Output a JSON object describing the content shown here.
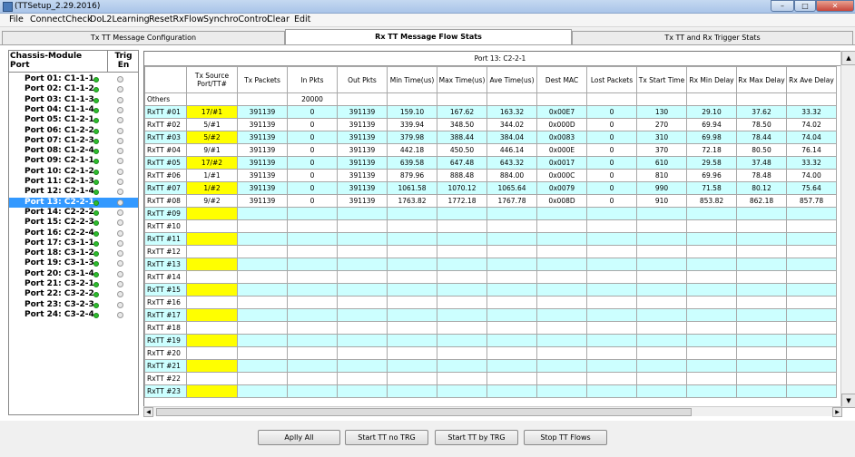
{
  "window": {
    "title": "(TTSetup_2.29.2016)",
    "min": "–",
    "max": "□",
    "close": "✕"
  },
  "menu": [
    "File",
    "ConnectCheck",
    "DoL2Learning",
    "ResetRxFlow",
    "SynchroControl",
    "Clear",
    "Edit"
  ],
  "tabs": [
    "Tx TT Message Configuration",
    "Rx TT Message Flow Stats",
    "Tx TT and Rx Trigger Stats"
  ],
  "left": {
    "h1": "Chassis-Module",
    "h2": "Port",
    "t1": "Trig",
    "t2": "En",
    "ports": [
      "Port 01:  C1-1-1",
      "Port 02:  C1-1-2",
      "Port 03:  C1-1-3",
      "Port 04:  C1-1-4",
      "Port 05:  C1-2-1",
      "Port 06:  C1-2-2",
      "Port 07:  C1-2-3",
      "Port 08:  C1-2-4",
      "Port 09:  C2-1-1",
      "Port 10:  C2-1-2",
      "Port 11:  C2-1-3",
      "Port 12:  C2-1-4",
      "Port 13:  C2-2-1",
      "Port 14:  C2-2-2",
      "Port 15:  C2-2-3",
      "Port 16:  C2-2-4",
      "Port 17:  C3-1-1",
      "Port 18:  C3-1-2",
      "Port 19:  C3-1-3",
      "Port 20:  C3-1-4",
      "Port 21:  C3-2-1",
      "Port 22:  C3-2-2",
      "Port 23:  C3-2-3",
      "Port 24:  C3-2-4"
    ],
    "selected_index": 12
  },
  "grid": {
    "port_label": "Port 13: C2-2-1",
    "headers": [
      "",
      "Tx Source Port/TT#",
      "Tx Packets",
      "In Pkts",
      "Out Pkts",
      "Min Time(us)",
      "Max Time(us)",
      "Ave Time(us)",
      "Dest MAC",
      "Lost Packets",
      "Tx Start Time",
      "Rx Min Delay",
      "Rx Max Delay",
      "Rx Ave Delay"
    ],
    "others": [
      "Others",
      "",
      "",
      "20000",
      "",
      "",
      "",
      "",
      "",
      "",
      "",
      "",
      "",
      ""
    ],
    "rows": [
      [
        "RxTT #01",
        "17/#1",
        "391139",
        "0",
        "391139",
        "159.10",
        "167.62",
        "163.32",
        "0x00E7",
        "0",
        "130",
        "29.10",
        "37.62",
        "33.32"
      ],
      [
        "RxTT #02",
        "5/#1",
        "391139",
        "0",
        "391139",
        "339.94",
        "348.50",
        "344.02",
        "0x000D",
        "0",
        "270",
        "69.94",
        "78.50",
        "74.02"
      ],
      [
        "RxTT #03",
        "5/#2",
        "391139",
        "0",
        "391139",
        "379.98",
        "388.44",
        "384.04",
        "0x0083",
        "0",
        "310",
        "69.98",
        "78.44",
        "74.04"
      ],
      [
        "RxTT #04",
        "9/#1",
        "391139",
        "0",
        "391139",
        "442.18",
        "450.50",
        "446.14",
        "0x000E",
        "0",
        "370",
        "72.18",
        "80.50",
        "76.14"
      ],
      [
        "RxTT #05",
        "17/#2",
        "391139",
        "0",
        "391139",
        "639.58",
        "647.48",
        "643.32",
        "0x0017",
        "0",
        "610",
        "29.58",
        "37.48",
        "33.32"
      ],
      [
        "RxTT #06",
        "1/#1",
        "391139",
        "0",
        "391139",
        "879.96",
        "888.48",
        "884.00",
        "0x000C",
        "0",
        "810",
        "69.96",
        "78.48",
        "74.00"
      ],
      [
        "RxTT #07",
        "1/#2",
        "391139",
        "0",
        "391139",
        "1061.58",
        "1070.12",
        "1065.64",
        "0x0079",
        "0",
        "990",
        "71.58",
        "80.12",
        "75.64"
      ],
      [
        "RxTT #08",
        "9/#2",
        "391139",
        "0",
        "391139",
        "1763.82",
        "1772.18",
        "1767.78",
        "0x008D",
        "0",
        "910",
        "853.82",
        "862.18",
        "857.78"
      ],
      [
        "RxTT #09",
        "",
        "",
        "",
        "",
        "",
        "",
        "",
        "",
        "",
        "",
        "",
        "",
        ""
      ],
      [
        "RxTT #10",
        "",
        "",
        "",
        "",
        "",
        "",
        "",
        "",
        "",
        "",
        "",
        "",
        ""
      ],
      [
        "RxTT #11",
        "",
        "",
        "",
        "",
        "",
        "",
        "",
        "",
        "",
        "",
        "",
        "",
        ""
      ],
      [
        "RxTT #12",
        "",
        "",
        "",
        "",
        "",
        "",
        "",
        "",
        "",
        "",
        "",
        "",
        ""
      ],
      [
        "RxTT #13",
        "",
        "",
        "",
        "",
        "",
        "",
        "",
        "",
        "",
        "",
        "",
        "",
        ""
      ],
      [
        "RxTT #14",
        "",
        "",
        "",
        "",
        "",
        "",
        "",
        "",
        "",
        "",
        "",
        "",
        ""
      ],
      [
        "RxTT #15",
        "",
        "",
        "",
        "",
        "",
        "",
        "",
        "",
        "",
        "",
        "",
        "",
        ""
      ],
      [
        "RxTT #16",
        "",
        "",
        "",
        "",
        "",
        "",
        "",
        "",
        "",
        "",
        "",
        "",
        ""
      ],
      [
        "RxTT #17",
        "",
        "",
        "",
        "",
        "",
        "",
        "",
        "",
        "",
        "",
        "",
        "",
        ""
      ],
      [
        "RxTT #18",
        "",
        "",
        "",
        "",
        "",
        "",
        "",
        "",
        "",
        "",
        "",
        "",
        ""
      ],
      [
        "RxTT #19",
        "",
        "",
        "",
        "",
        "",
        "",
        "",
        "",
        "",
        "",
        "",
        "",
        ""
      ],
      [
        "RxTT #20",
        "",
        "",
        "",
        "",
        "",
        "",
        "",
        "",
        "",
        "",
        "",
        "",
        ""
      ],
      [
        "RxTT #21",
        "",
        "",
        "",
        "",
        "",
        "",
        "",
        "",
        "",
        "",
        "",
        "",
        ""
      ],
      [
        "RxTT #22",
        "",
        "",
        "",
        "",
        "",
        "",
        "",
        "",
        "",
        "",
        "",
        "",
        ""
      ],
      [
        "RxTT #23",
        "",
        "",
        "",
        "",
        "",
        "",
        "",
        "",
        "",
        "",
        "",
        "",
        ""
      ]
    ]
  },
  "buttons": [
    "Aplly All",
    "Start TT no TRG",
    "Start TT by TRG",
    "Stop TT Flows"
  ],
  "colors": {
    "cyan": "#ccffff",
    "yellow": "#ffff00",
    "selected": "#3399ff",
    "ok": "#2ebd2e"
  }
}
